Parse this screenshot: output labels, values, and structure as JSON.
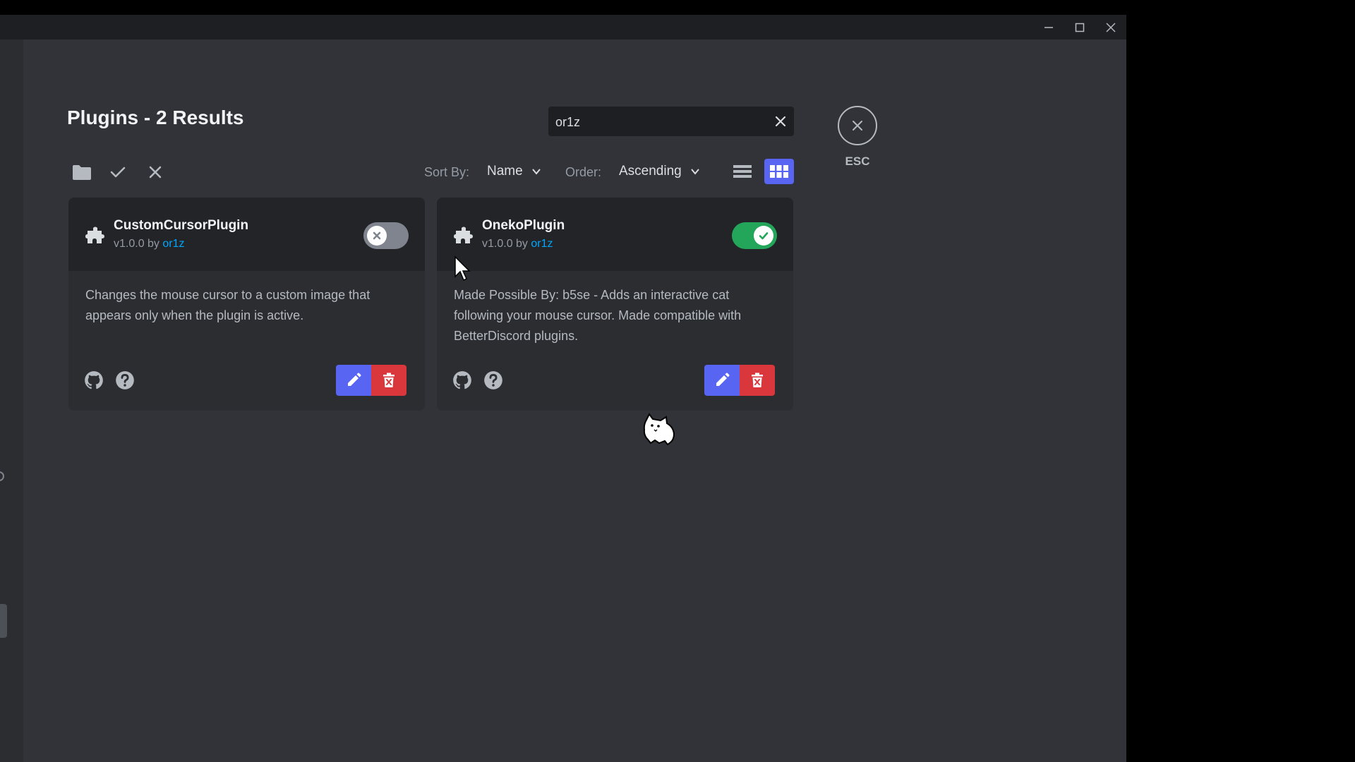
{
  "window": {
    "controls": [
      "minimize-icon",
      "maximize-icon",
      "close-icon"
    ]
  },
  "header": {
    "title": "Plugins - 2 Results",
    "esc_label": "ESC"
  },
  "search": {
    "value": "or1z"
  },
  "toolbar": {
    "icons": [
      "folder-icon",
      "check-icon",
      "close-icon"
    ],
    "sort_label": "Sort By:",
    "sort_value": "Name",
    "order_label": "Order:",
    "order_value": "Ascending",
    "views": [
      "list-view-icon",
      "grid-view-icon"
    ],
    "active_view": "grid"
  },
  "plugins": [
    {
      "name": "CustomCursorPlugin",
      "version_prefix": "v1.0.0 by ",
      "author": "or1z",
      "enabled": false,
      "description": "Changes the mouse cursor to a custom image that appears only when the plugin is active."
    },
    {
      "name": "OnekoPlugin",
      "version_prefix": "v1.0.0 by ",
      "author": "or1z",
      "enabled": true,
      "description": "Made Possible By: b5se - Adds an interactive cat following your mouse cursor. Made compatible with BetterDiscord plugins."
    }
  ],
  "colors": {
    "background": "#313338",
    "card": "#2b2d31",
    "card_header": "#232428",
    "accent_blue": "#5865f2",
    "toggle_on": "#23a55a",
    "toggle_off": "#80848e",
    "danger": "#da373c",
    "link": "#00a8fc"
  }
}
